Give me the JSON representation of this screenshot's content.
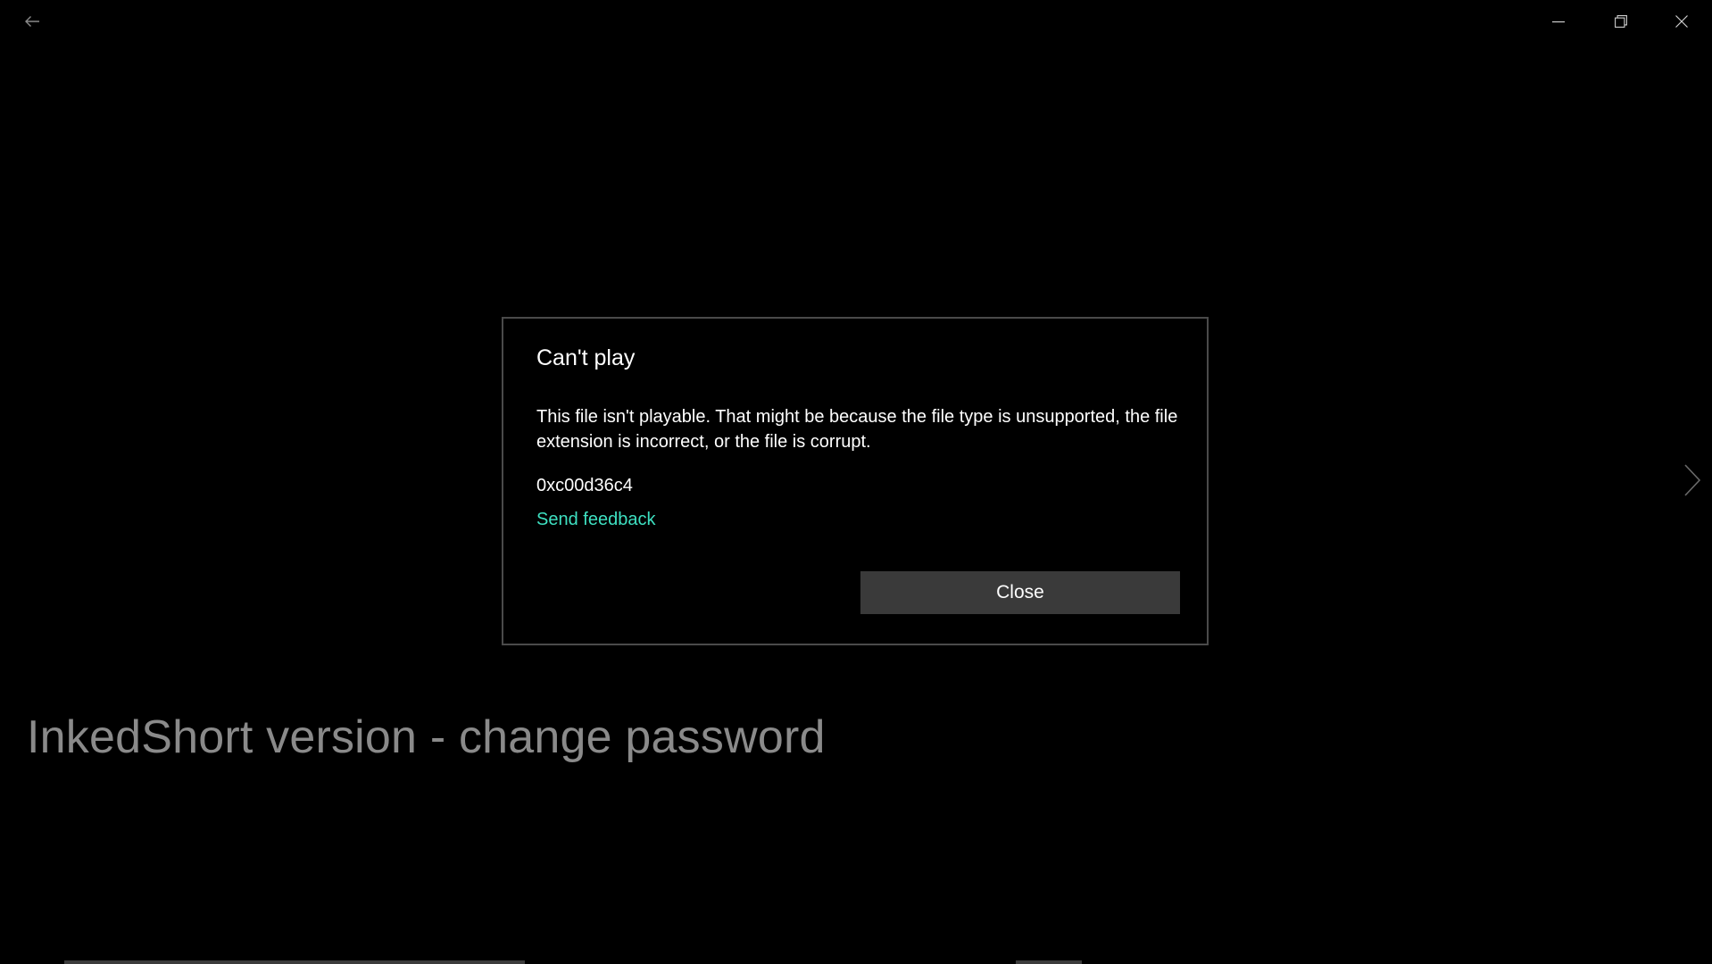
{
  "window": {
    "back_icon": "arrow-left-icon",
    "minimize_icon": "minimize-icon",
    "restore_icon": "restore-icon",
    "close_icon": "close-icon",
    "next_icon": "chevron-right-icon"
  },
  "video": {
    "title": "InkedShort version - change password"
  },
  "dialog": {
    "title": "Can't play",
    "message": "This file isn't playable. That might be because the file type is unsupported, the file extension is incorrect, or the file is corrupt.",
    "error_code": "0xc00d36c4",
    "feedback_label": "Send feedback",
    "close_label": "Close"
  },
  "colors": {
    "background": "#000000",
    "accent_link": "#3ee0c1",
    "button_bg": "#3a3a3a",
    "muted_text": "#8a8a8a"
  }
}
